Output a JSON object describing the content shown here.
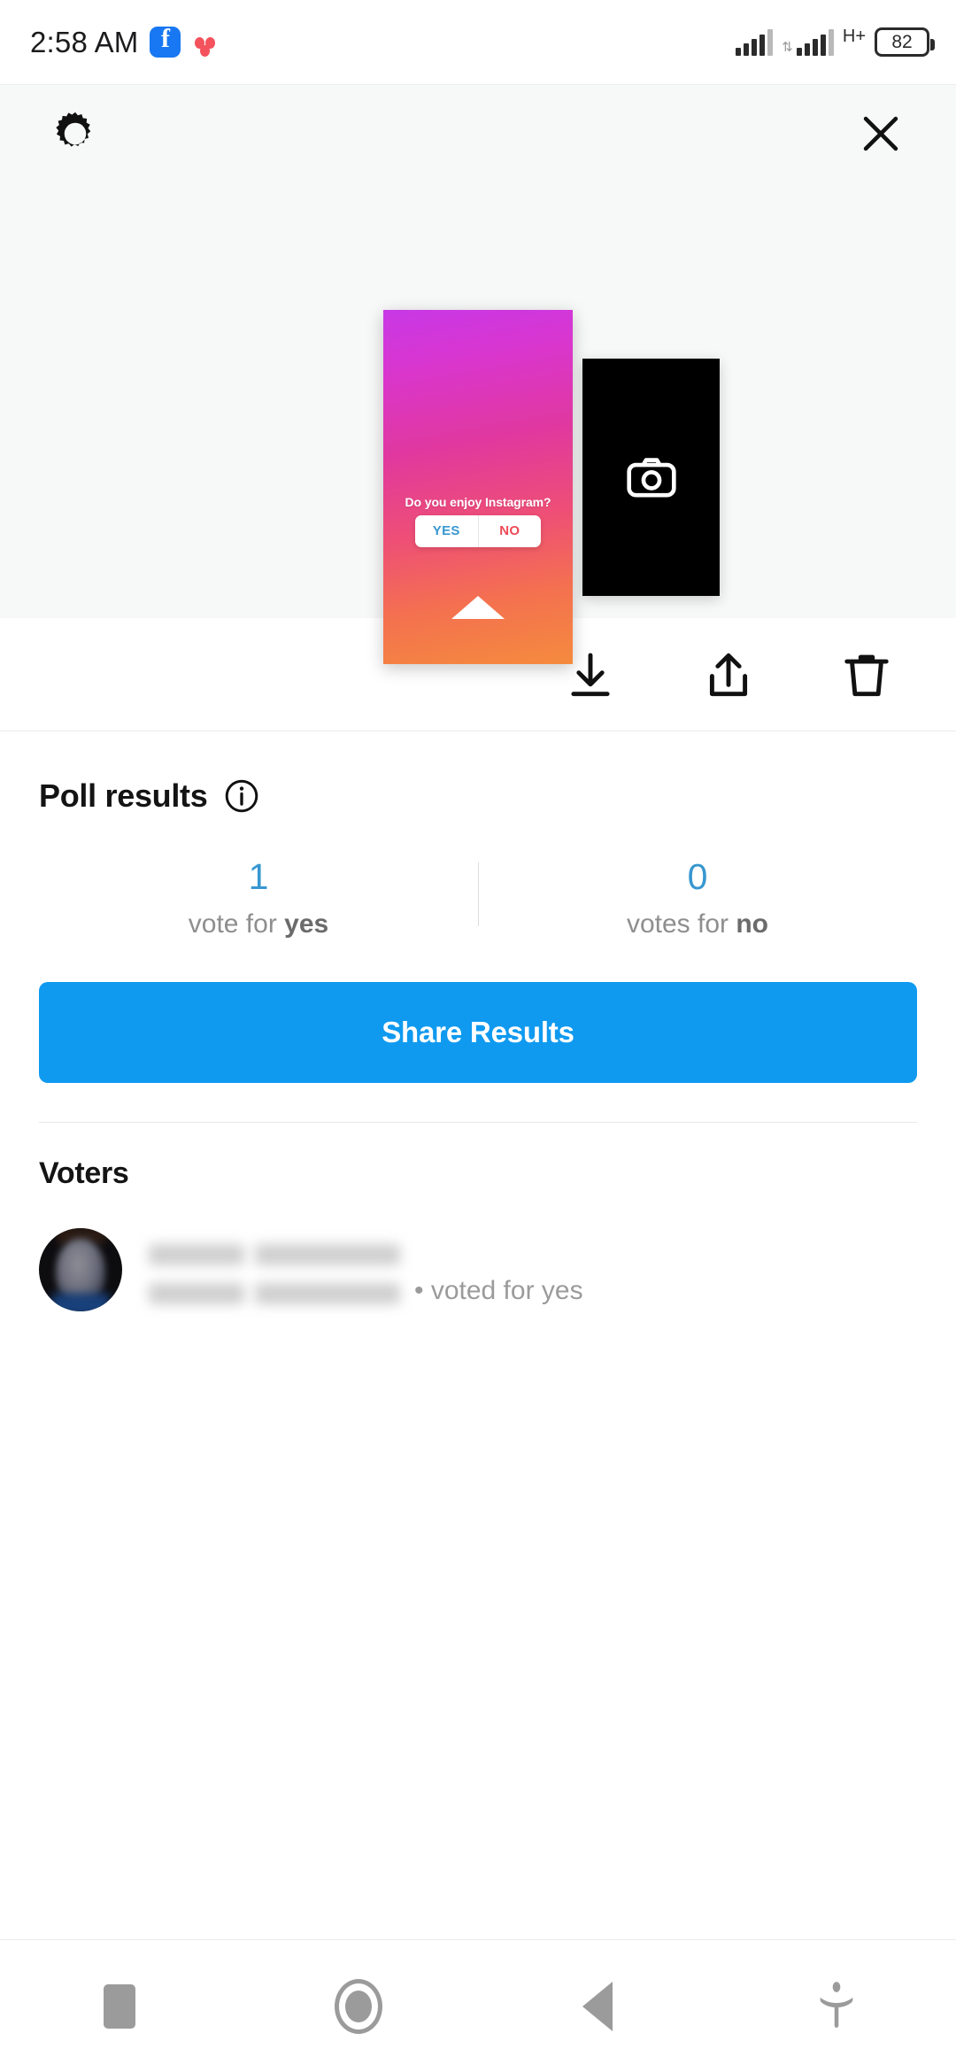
{
  "status_bar": {
    "time": "2:58 AM",
    "icons": [
      "facebook-icon",
      "dots-notification-icon"
    ],
    "network_label": "H+",
    "battery_level": "82",
    "signal_bars": 5
  },
  "preview": {
    "settings_icon": "gear-icon",
    "close_icon": "close-icon",
    "story_card": {
      "poll_question": "Do you enjoy Instagram?",
      "option_yes": "YES",
      "option_no": "NO",
      "yes_color": "#3897d0",
      "no_color": "#ed4956",
      "gradient_start": "#c838e6",
      "gradient_end": "#f58b3e"
    },
    "secondary_card": {
      "icon": "camera-icon",
      "background": "#000000"
    }
  },
  "actions": [
    {
      "name": "download-button",
      "icon": "download-icon"
    },
    {
      "name": "share-button",
      "icon": "share-upload-icon"
    },
    {
      "name": "delete-button",
      "icon": "trash-icon"
    }
  ],
  "results": {
    "title": "Poll results",
    "info_icon": "info-circle-icon",
    "yes": {
      "count": "1",
      "label_prefix": "vote for ",
      "label_bold": "yes"
    },
    "no": {
      "count": "0",
      "label_prefix": "votes for ",
      "label_bold": "no"
    },
    "count_color": "#3897d0",
    "share_button_label": "Share Results",
    "share_button_color": "#0f9af0"
  },
  "voters": {
    "title": "Voters",
    "list": [
      {
        "avatar": "user-avatar",
        "name_redacted": true,
        "vote_text": "• voted for yes"
      }
    ]
  },
  "navbar": {
    "buttons": [
      {
        "name": "nav-recents",
        "icon": "square-icon"
      },
      {
        "name": "nav-home",
        "icon": "circle-icon"
      },
      {
        "name": "nav-back",
        "icon": "triangle-back-icon"
      },
      {
        "name": "nav-accessibility",
        "icon": "accessibility-icon"
      }
    ]
  }
}
